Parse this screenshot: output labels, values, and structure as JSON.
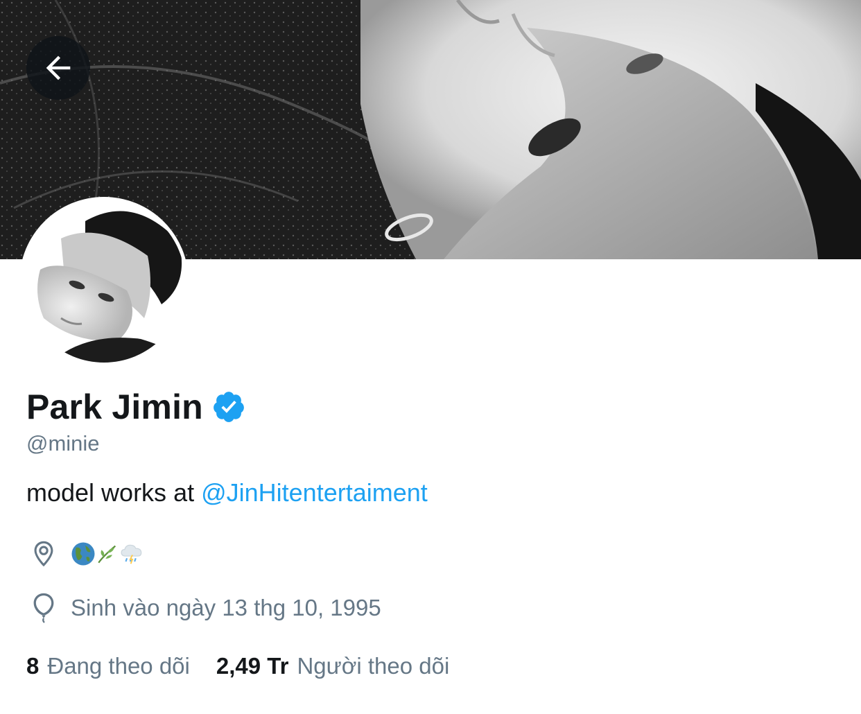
{
  "profile": {
    "name": "Park Jimin",
    "handle": "@minie",
    "bio_prefix": "model works at ",
    "bio_mention": "@JinHitentertaiment",
    "location_emoji": [
      "🌎",
      "🌿",
      "🌧"
    ],
    "birthday": "Sinh vào ngày 13 thg 10, 1995",
    "following_count": "8",
    "following_label": "Đang theo dõi",
    "followers_count": "2,49 Tr",
    "followers_label": "Người theo dõi"
  },
  "icons": {
    "back": "back-arrow-icon",
    "verified": "verified-badge-icon",
    "location": "location-pin-icon",
    "birthday": "balloon-icon"
  },
  "colors": {
    "accent": "#1da1f2",
    "text_primary": "#14171a",
    "text_secondary": "#657786"
  }
}
